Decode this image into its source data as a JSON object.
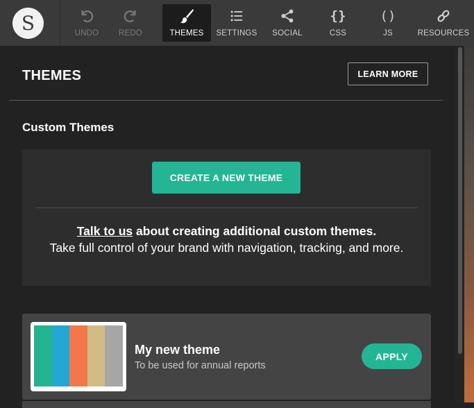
{
  "logo": {
    "letter": "S"
  },
  "toolbar": {
    "items": [
      {
        "label": "UNDO",
        "icon": "undo-icon",
        "state": "disabled"
      },
      {
        "label": "REDO",
        "icon": "redo-icon",
        "state": "disabled"
      },
      {
        "label": "THEMES",
        "icon": "paintbrush-icon",
        "state": "active"
      },
      {
        "label": "SETTINGS",
        "icon": "list-icon",
        "state": "normal"
      },
      {
        "label": "SOCIAL",
        "icon": "share-icon",
        "state": "normal"
      },
      {
        "label": "CSS",
        "icon": "braces-icon",
        "glyph": "{}",
        "state": "normal"
      },
      {
        "label": "JS",
        "icon": "parentheses-icon",
        "glyph": "()",
        "state": "normal"
      },
      {
        "label": "RESOURCES",
        "icon": "link-icon",
        "state": "normal"
      }
    ]
  },
  "panel": {
    "title": "THEMES",
    "learn_more": "LEARN MORE",
    "section_title": "Custom Themes",
    "create_button": "CREATE A NEW THEME",
    "talk_link": "Talk to us",
    "talk_rest": " about creating additional custom themes.",
    "description": "Take full control of your brand with navigation, tracking, and more."
  },
  "themes": [
    {
      "name": "My new theme",
      "description": "To be used for annual reports",
      "apply_label": "APPLY",
      "colors": [
        "#24b391",
        "#23a6d3",
        "#f2784b",
        "#d2bb84",
        "#a6a6a6"
      ]
    }
  ],
  "colors": {
    "accent": "#23b594",
    "toolbar_bg": "#3a3a3a",
    "panel_bg": "#222222",
    "card_bg": "#444444"
  }
}
